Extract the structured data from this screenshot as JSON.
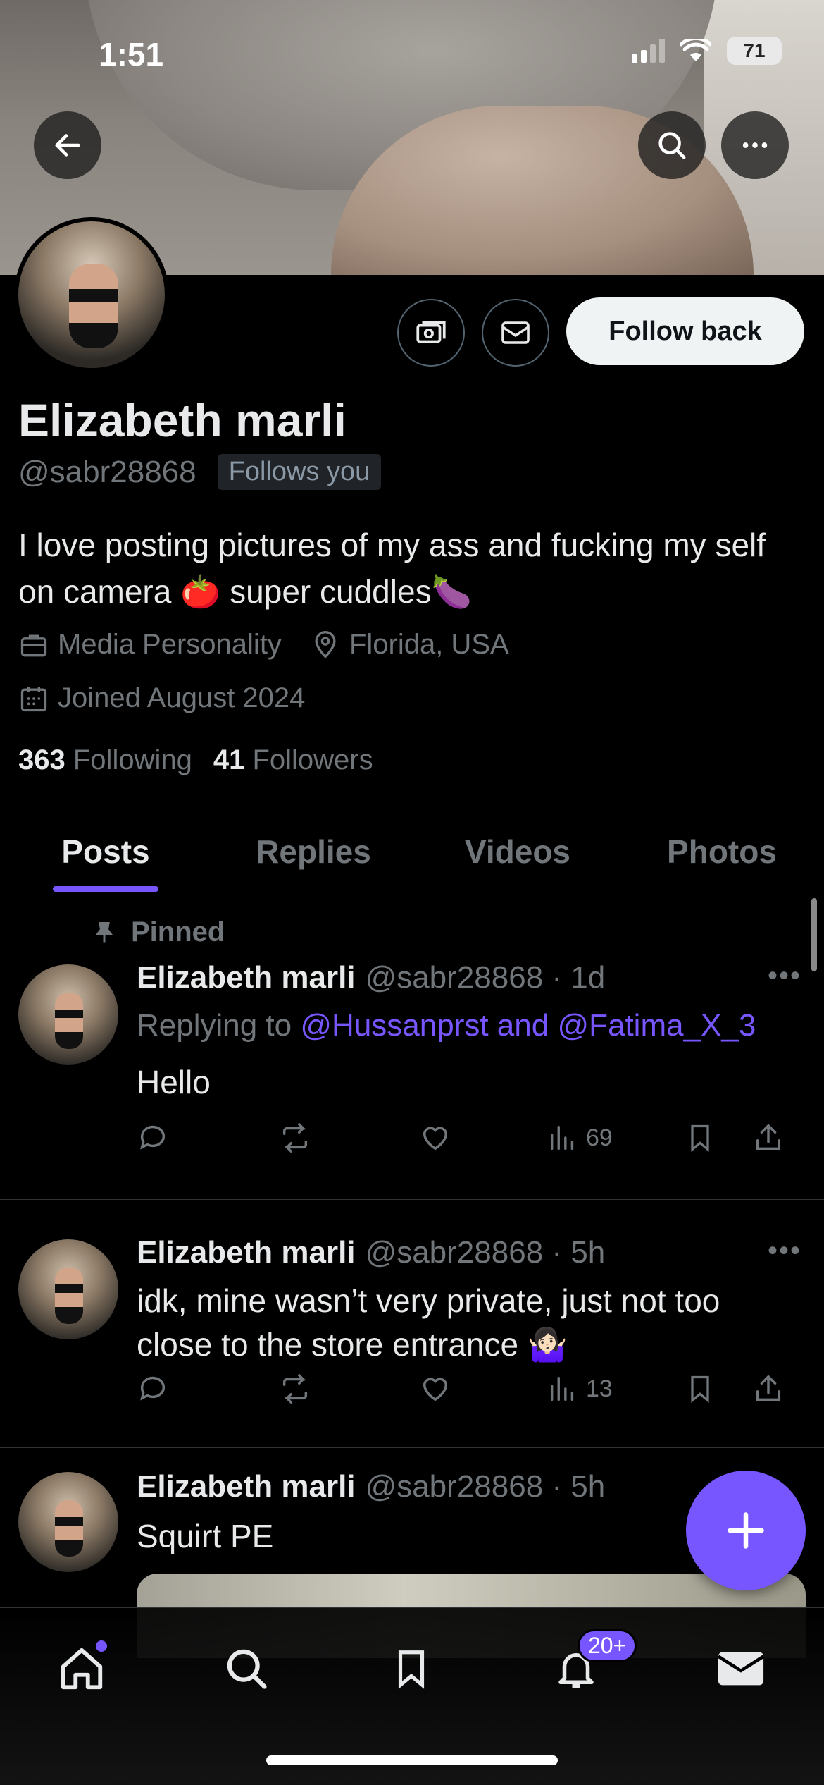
{
  "status_bar": {
    "time": "1:51",
    "battery": "71"
  },
  "profile": {
    "name": "Elizabeth marli",
    "handle": "@sabr28868",
    "follows_you": "Follows you",
    "follow_button": "Follow back",
    "bio": "I love posting pictures of my ass and fucking my self on camera 🍅 super cuddles🍆",
    "category": "Media Personality",
    "location": "Florida, USA",
    "joined": "Joined August 2024",
    "following_count": "363",
    "following_label": "Following",
    "followers_count": "41",
    "followers_label": "Followers"
  },
  "tabs": [
    {
      "label": "Posts",
      "active": true
    },
    {
      "label": "Replies",
      "active": false
    },
    {
      "label": "Videos",
      "active": false
    },
    {
      "label": "Photos",
      "active": false
    }
  ],
  "posts": [
    {
      "pinned_label": "Pinned",
      "name": "Elizabeth marli",
      "handle_time": "@sabr28868 · 1d",
      "replying_prefix": "Replying to",
      "replying_mentions": "@Hussanprst and @Fatima_X_3",
      "text": "Hello",
      "views": "69"
    },
    {
      "name": "Elizabeth marli",
      "handle_time": "@sabr28868 · 5h",
      "text": "idk, mine wasn’t very private, just not too close to the store entrance 🤷🏻‍♀️",
      "views": "13"
    },
    {
      "name": "Elizabeth marli",
      "handle_time": "@sabr28868 · 5h",
      "text": "Squirt PE"
    }
  ],
  "bottom_nav": {
    "notifications_badge": "20+"
  },
  "colors": {
    "accent": "#7856ff",
    "background": "#000000",
    "muted": "#71767b",
    "text": "#e7e9ea"
  }
}
